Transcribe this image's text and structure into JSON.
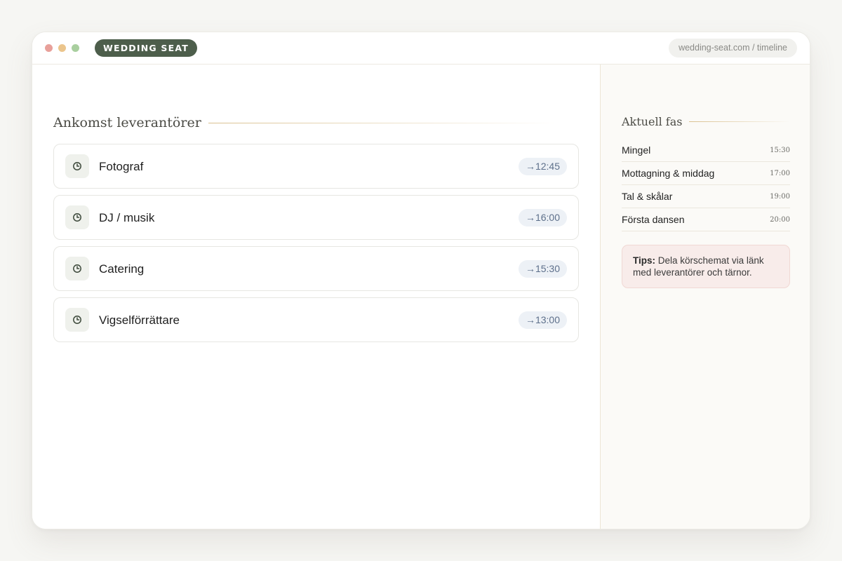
{
  "window": {
    "brand": "WEDDING SEAT",
    "url": "wedding-seat.com / timeline"
  },
  "main": {
    "title": "Ankomst leverantörer",
    "vendors": [
      {
        "label": "Fotograf",
        "time": "→12:45",
        "icon": "clock-icon"
      },
      {
        "label": "DJ / musik",
        "time": "→16:00",
        "icon": "clock-icon"
      },
      {
        "label": "Catering",
        "time": "→15:30",
        "icon": "clock-icon"
      },
      {
        "label": "Vigselförrättare",
        "time": "→13:00",
        "icon": "clock-icon"
      }
    ]
  },
  "side": {
    "title": "Aktuell fas",
    "phases": [
      {
        "name": "Mingel",
        "time": "15:30"
      },
      {
        "name": "Mottagning & middag",
        "time": "17:00"
      },
      {
        "name": "Tal & skålar",
        "time": "19:00"
      },
      {
        "name": "Första dansen",
        "time": "20:00"
      }
    ],
    "tip": {
      "label": "Tips:",
      "text": "Dela körschemat via länk med leverantörer och tärnor."
    }
  },
  "colors": {
    "brand": "#4d5e4b",
    "accent_rule": "#d9c08f",
    "time_pill_bg": "#edf1f6",
    "tip_bg": "#f8ecea"
  }
}
